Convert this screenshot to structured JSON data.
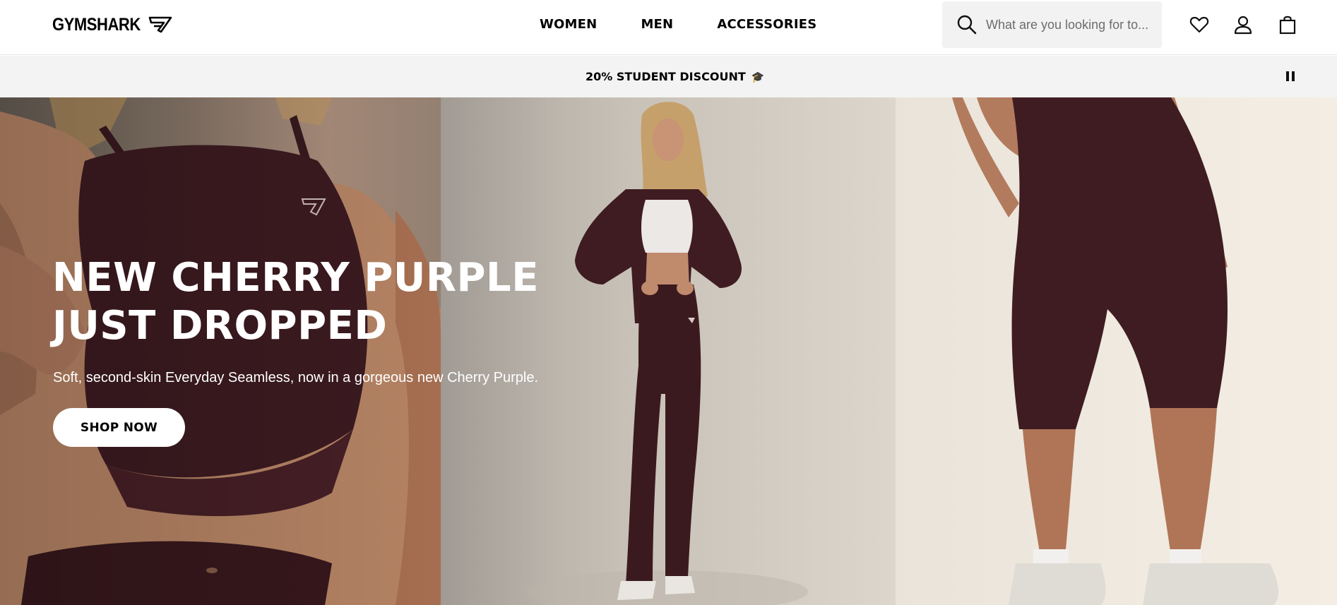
{
  "brand": {
    "logo_text": "GYMSHARK",
    "logo_icon": "shark-logo-icon"
  },
  "nav": {
    "items": [
      {
        "label": "WOMEN"
      },
      {
        "label": "MEN"
      },
      {
        "label": "ACCESSORIES"
      }
    ]
  },
  "search": {
    "placeholder": "What are you looking for to...",
    "icon": "search-icon"
  },
  "header_icons": [
    "heart-icon",
    "account-icon",
    "bag-icon"
  ],
  "promo": {
    "text": "20% STUDENT DISCOUNT",
    "emoji": "🎓",
    "pause_icon": "pause-icon"
  },
  "hero": {
    "title_line1": "NEW CHERRY PURPLE",
    "title_line2": "JUST DROPPED",
    "subtitle": "Soft, second-skin Everyday Seamless, now in a gorgeous new Cherry Purple.",
    "cta_label": "SHOP NOW"
  },
  "colors": {
    "product": "#3f1c22",
    "promo_bg": "#f3f3f3",
    "search_bg": "#f2f2f2",
    "text": "#000000"
  }
}
